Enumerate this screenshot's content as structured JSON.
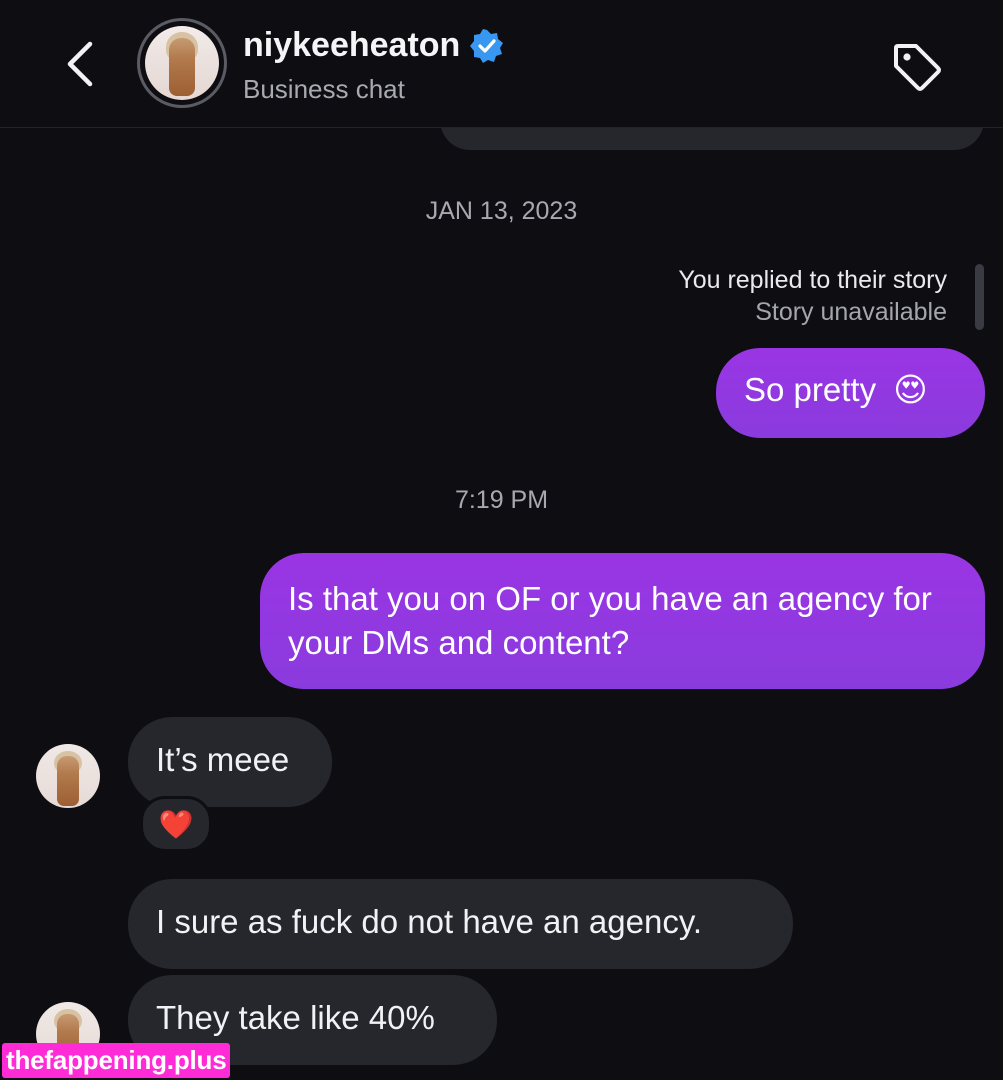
{
  "header": {
    "username": "niykeeheaton",
    "subtitle": "Business chat",
    "verified": true,
    "icons": {
      "back": "chevron-left-icon",
      "tag": "tag-icon",
      "verified": "verified-badge-icon"
    }
  },
  "colors": {
    "background": "#0d0d12",
    "outgoing_bubble": "#8a3bde",
    "incoming_bubble": "#26262d",
    "verified_blue": "#3897f0",
    "watermark_bg": "#ff2bd6"
  },
  "conversation": {
    "date_separator": "JAN 13, 2023",
    "story_reply": {
      "label": "You replied to their story",
      "status": "Story unavailable"
    },
    "time_separator": "7:19 PM",
    "messages": [
      {
        "direction": "outgoing",
        "text": "So pretty",
        "emoji": "😍"
      },
      {
        "direction": "outgoing",
        "text": "Is that you on OF or you have an agency for your DMs and content?"
      },
      {
        "direction": "incoming",
        "text": "It’s meee",
        "reaction": "❤️"
      },
      {
        "direction": "incoming",
        "text": "I sure as fuck do not have an agency."
      },
      {
        "direction": "incoming",
        "text": "They take like 40%"
      }
    ]
  },
  "watermark": "thefappening.plus"
}
